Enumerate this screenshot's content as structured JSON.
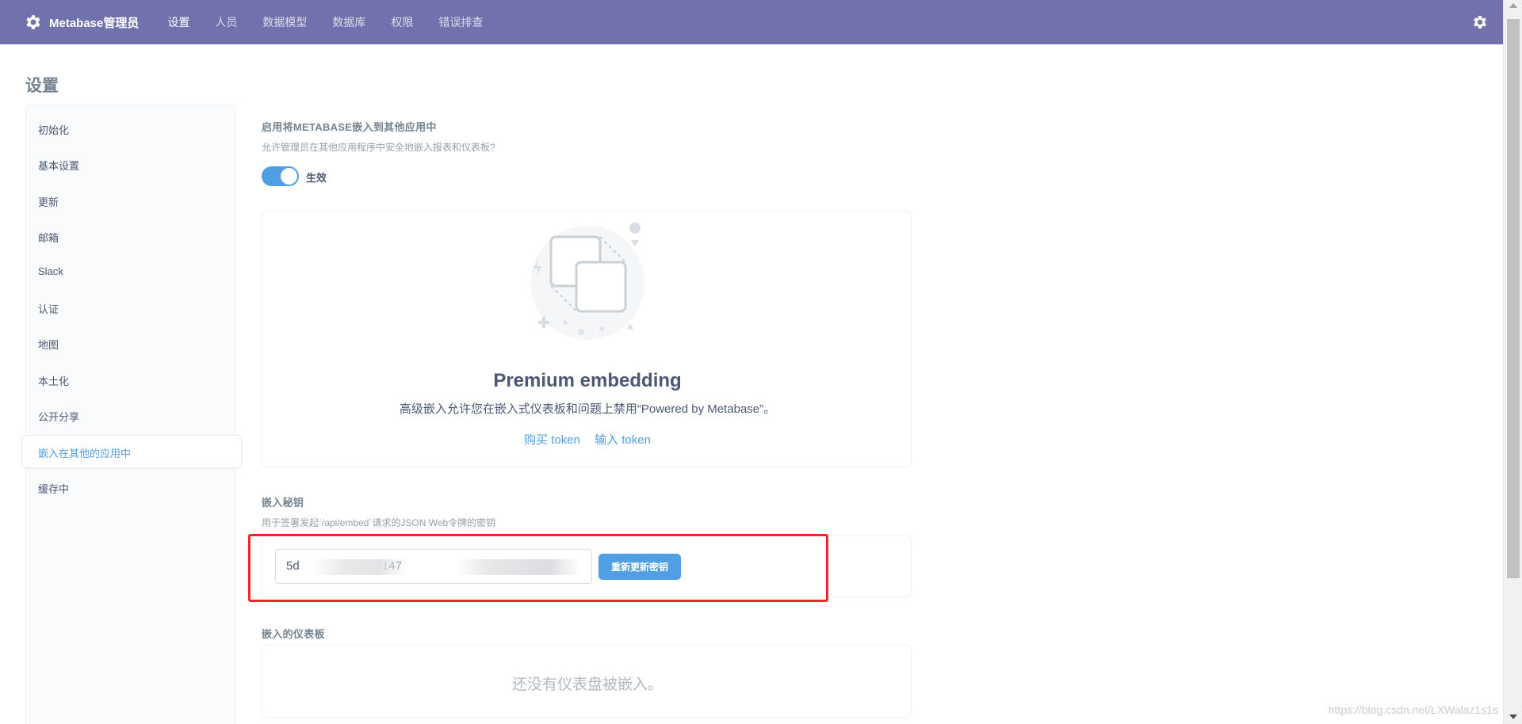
{
  "app": {
    "brand": "Metabase管理员",
    "nav": [
      {
        "label": "设置",
        "active": true
      },
      {
        "label": "人员",
        "active": false
      },
      {
        "label": "数据模型",
        "active": false
      },
      {
        "label": "数据库",
        "active": false
      },
      {
        "label": "权限",
        "active": false
      },
      {
        "label": "错误排查",
        "active": false
      }
    ],
    "accent_color": "#509ee3",
    "nav_color": "#7172ad"
  },
  "page": {
    "title": "设置"
  },
  "sidebar": {
    "items": [
      {
        "label": "初始化",
        "active": false
      },
      {
        "label": "基本设置",
        "active": false
      },
      {
        "label": "更新",
        "active": false
      },
      {
        "label": "邮箱",
        "active": false
      },
      {
        "label": "Slack",
        "active": false
      },
      {
        "label": "认证",
        "active": false
      },
      {
        "label": "地图",
        "active": false
      },
      {
        "label": "本土化",
        "active": false
      },
      {
        "label": "公开分享",
        "active": false
      },
      {
        "label": "嵌入在其他的应用中",
        "active": true
      },
      {
        "label": "缓存中",
        "active": false
      }
    ]
  },
  "embedding": {
    "title": "启用将METABASE嵌入到其他应用中",
    "description": "允许管理员在其他应用程序中安全地嵌入报表和仪表板?",
    "toggle_label": "生效",
    "toggle_on": true
  },
  "premium": {
    "title": "Premium embedding",
    "description": "高级嵌入允许您在嵌入式仪表板和问题上禁用“Powered by Metabase”。",
    "buy_link": "购买 token",
    "enter_link": "输入 token"
  },
  "secret_key": {
    "title": "嵌入秘钥",
    "description": "用于签署发起`/api/embed`请求的JSON Web令牌的密钥",
    "value": "5d                  b76f147                                  3ec4b",
    "regenerate_label": "重新更新密钥",
    "highlight_color": "#f0262a"
  },
  "dashboards": {
    "title": "嵌入的仪表板",
    "empty_text": "还没有仪表盘被嵌入。"
  },
  "watermark": "https://blog.csdn.net/LXWalaz1s1s"
}
